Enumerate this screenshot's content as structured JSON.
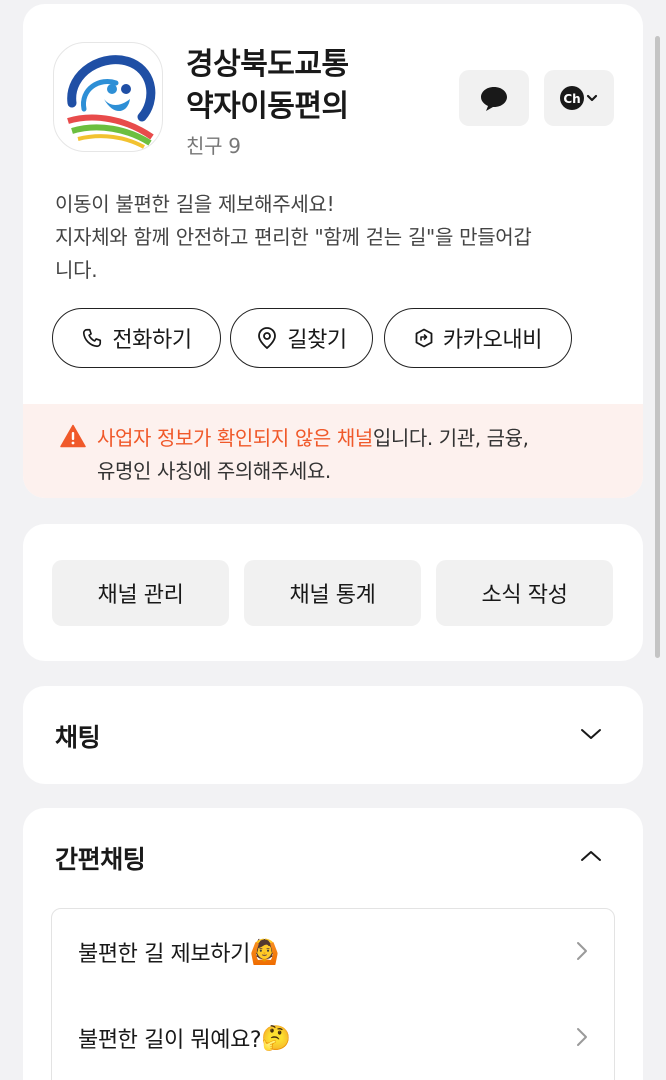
{
  "profile": {
    "name_line1": "경상북도교통",
    "name_line2": "약자이동편의",
    "friends": "친구 9",
    "description_line1": "이동이 불편한 길을 제보해주세요!",
    "description_line2": "지자체와 함께 안전하고 편리한 \"함께 걷는 길\"을 만들어갑",
    "description_line3": "니다.",
    "icons": {
      "chat": "speech-bubble-icon",
      "channel": "ch-icon"
    },
    "actions": [
      {
        "label": "전화하기",
        "icon": "phone-icon"
      },
      {
        "label": "길찾기",
        "icon": "location-pin-icon"
      },
      {
        "label": "카카오내비",
        "icon": "navi-icon"
      }
    ]
  },
  "warning": {
    "highlight": "사업자 정보가 확인되지 않은 채널",
    "rest_line1": "입니다. 기관, 금융,",
    "line2": "유명인 사칭에 주의해주세요.",
    "color": "#f0592a"
  },
  "manage": {
    "buttons": [
      "채널 관리",
      "채널 통계",
      "소식 작성"
    ]
  },
  "chat_section": {
    "title": "채팅"
  },
  "quick_chat": {
    "title": "간편채팅",
    "items": [
      {
        "label": "불편한 길 제보하기",
        "emoji": "🙆"
      },
      {
        "label": "불편한 길이 뭐예요?",
        "emoji": "🤔"
      }
    ]
  }
}
